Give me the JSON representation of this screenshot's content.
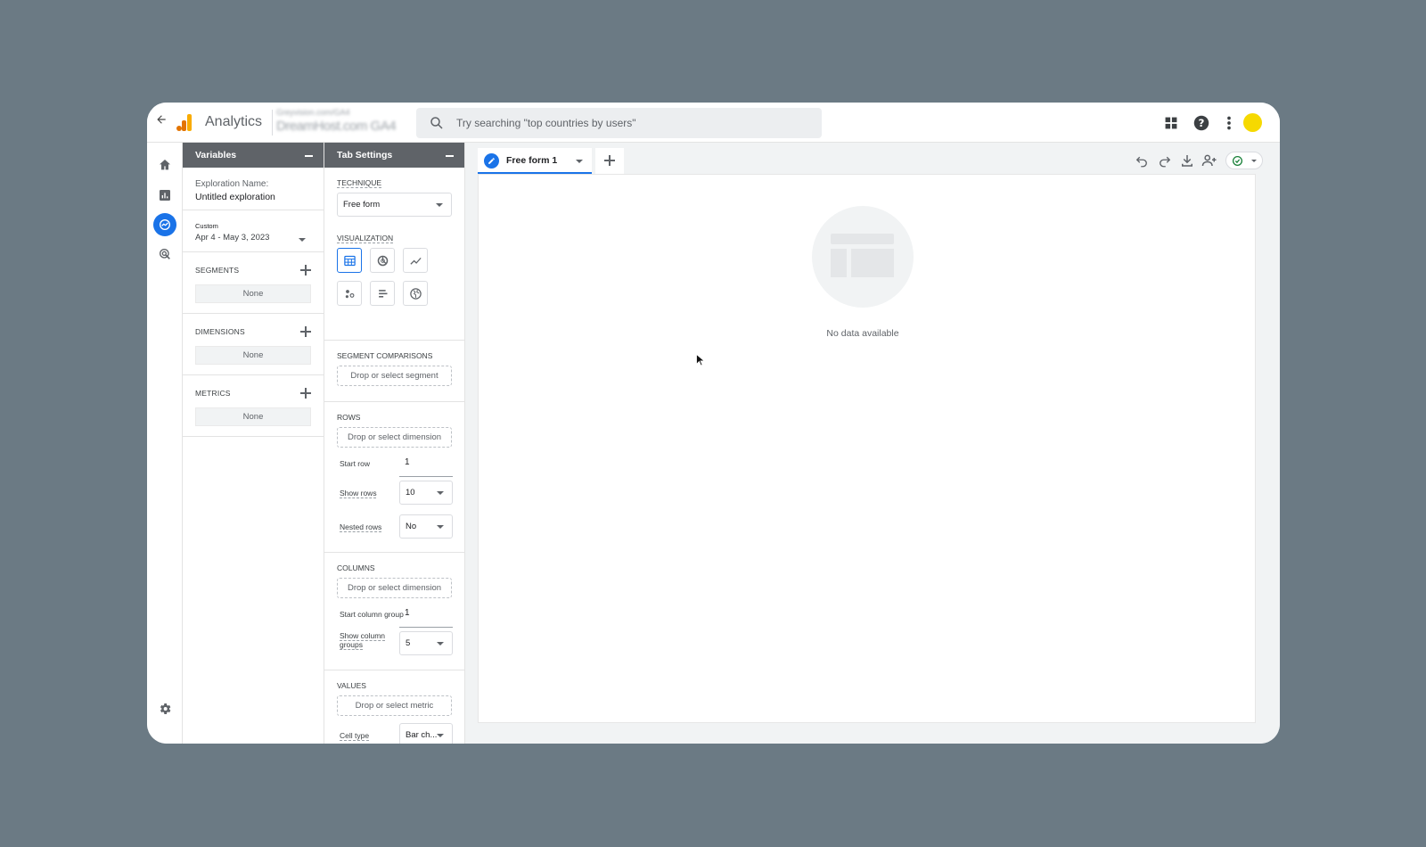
{
  "header": {
    "app_title": "Analytics",
    "account_line1": "Greyvision.com/GA4",
    "account_line2": "DreamHost.com GA4",
    "search_placeholder": "Try searching \"top countries by users\""
  },
  "variables": {
    "title": "Variables",
    "exploration_label": "Exploration Name:",
    "exploration_name": "Untitled exploration",
    "date_badge": "Custom",
    "date_range": "Apr 4 - May 3, 2023",
    "segments_title": "SEGMENTS",
    "segments_value": "None",
    "dimensions_title": "DIMENSIONS",
    "dimensions_value": "None",
    "metrics_title": "METRICS",
    "metrics_value": "None"
  },
  "tab_settings": {
    "title": "Tab Settings",
    "technique_title": "TECHNIQUE",
    "technique_value": "Free form",
    "visualization_title": "VISUALIZATION",
    "segment_comparisons_title": "SEGMENT COMPARISONS",
    "segment_drop": "Drop or select segment",
    "rows_title": "ROWS",
    "rows_drop": "Drop or select dimension",
    "start_row_label": "Start row",
    "start_row_value": "1",
    "show_rows_label": "Show rows",
    "show_rows_value": "10",
    "nested_rows_label": "Nested rows",
    "nested_rows_value": "No",
    "columns_title": "COLUMNS",
    "columns_drop": "Drop or select dimension",
    "start_col_label": "Start column group",
    "start_col_value": "1",
    "show_col_label_1": "Show column",
    "show_col_label_2": "groups",
    "show_col_value": "5",
    "values_title": "VALUES",
    "values_drop": "Drop or select metric",
    "cell_type_label": "Cell type",
    "cell_type_value": "Bar ch..."
  },
  "main": {
    "tab_name": "Free form 1",
    "empty_text": "No data available"
  },
  "colors": {
    "accent": "#1a73e8",
    "panel_header": "#5f6368",
    "avatar": "#f6d900",
    "success": "#188038"
  }
}
